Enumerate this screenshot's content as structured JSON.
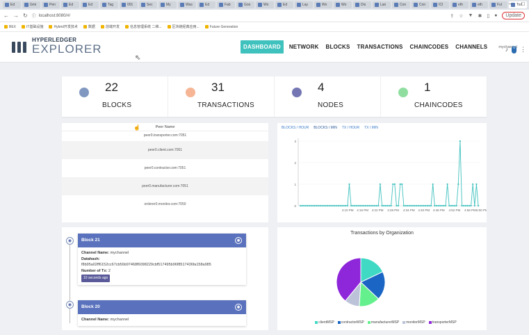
{
  "browser": {
    "tabs": [
      "Ed",
      "Gmi",
      "Pen",
      "Ed",
      "Ed",
      "Tag",
      "001",
      "Sec",
      "My",
      "Was",
      "Ed",
      "Fab",
      "Goo",
      "Wo",
      "Ed",
      "Lay",
      "Wo",
      "Wo",
      "Dis",
      "Lan",
      "Con",
      "Con",
      "ICI",
      "eth",
      "eth",
      "Ful",
      "Tod"
    ],
    "new_tab": "+",
    "url": "localhost:8080/#/",
    "profile_label": "Update",
    "bookmarks": [
      "BEX",
      "IT基础设施",
      "Hybrid开发技术",
      "数据",
      "前端开发",
      "信息管理系统 二维...",
      "区块链经典应用...",
      "Future Generation"
    ]
  },
  "app": {
    "logo_top": "HYPERLEDGER",
    "logo_bottom": "EXPLORER",
    "nav": [
      {
        "label": "DASHBOARD",
        "active": true
      },
      {
        "label": "NETWORK",
        "active": false
      },
      {
        "label": "BLOCKS",
        "active": false
      },
      {
        "label": "TRANSACTIONS",
        "active": false
      },
      {
        "label": "CHAINCODES",
        "active": false
      },
      {
        "label": "CHANNELS",
        "active": false
      }
    ],
    "channel": "mychannel",
    "notification_count": "0"
  },
  "stats": [
    {
      "value": "22",
      "label": "BLOCKS",
      "icon": "blocks-icon",
      "color": "#6a86b5"
    },
    {
      "value": "31",
      "label": "TRANSACTIONS",
      "icon": "transactions-icon",
      "color": "#f4a882"
    },
    {
      "value": "4",
      "label": "NODES",
      "icon": "nodes-icon",
      "color": "#5b5ea6"
    },
    {
      "value": "1",
      "label": "CHAINCODES",
      "icon": "chaincodes-icon",
      "color": "#7bd88f"
    }
  ],
  "peers": {
    "header": "Peer Name",
    "rows": [
      "peer0.transporter.com:7051",
      "peer0.client.com:7051",
      "peer0.contractor.com:7051",
      "peer0.manufacturer.com:7051",
      "orderer0.monitor.com:7050"
    ]
  },
  "line_chart": {
    "tabs": [
      "BLOCKS / HOUR",
      "BLOCKS / MIN",
      "TX / HOUR",
      "TX / MIN"
    ]
  },
  "chart_data": [
    {
      "type": "line",
      "x": [
        "4:10 PM",
        "4:16 PM",
        "4:22 PM",
        "4:28 PM",
        "4:34 PM",
        "4:40 PM",
        "4:46 PM",
        "4:52 PM",
        "4:58 PM",
        "5:00 PM"
      ],
      "series": [
        {
          "values": [
            0,
            0,
            0,
            0,
            0,
            0,
            0,
            0,
            0,
            0,
            0,
            0,
            0,
            0,
            0,
            0,
            0,
            0,
            0,
            0,
            0,
            0,
            0,
            0,
            0,
            0,
            0,
            1,
            0,
            0,
            0,
            0,
            0,
            0,
            0,
            0,
            0,
            0,
            0,
            0,
            0,
            0,
            0,
            0,
            1,
            0,
            0,
            0,
            0,
            0,
            0,
            1,
            1,
            0,
            0,
            1,
            1,
            0,
            0,
            0,
            0,
            0,
            0,
            0,
            0,
            0,
            0,
            0,
            0,
            0,
            0,
            0,
            0,
            1,
            0,
            0,
            0,
            0,
            0,
            0,
            0,
            1,
            0,
            0,
            0,
            0,
            0,
            1,
            3,
            0,
            0,
            0,
            0,
            0,
            0,
            1,
            0,
            1,
            0
          ]
        }
      ],
      "ylim": [
        0,
        3
      ],
      "yticks": [
        "0",
        "1",
        "2",
        "3"
      ],
      "color": "#3fc1bd"
    },
    {
      "type": "pie",
      "title": "Transactions by Organization",
      "categories": [
        "clientMSP",
        "contractorMSP",
        "manufacturerMSP",
        "monitorMSP",
        "transporterMSP"
      ],
      "values": [
        18,
        19,
        14,
        10,
        39
      ],
      "colors": [
        "#3fd9c4",
        "#1b66c4",
        "#65f08e",
        "#bcc3d9",
        "#8e26d9"
      ]
    }
  ],
  "blocks_list": [
    {
      "title": "Block 21",
      "channel_label": "Channel Name:",
      "channel": "mychannel",
      "datahash_label": "Datahash:",
      "datahash": "f8b95a02ff6152cc67cb56b97468f6098229cbf517495b96f8517436fa158a985",
      "tx_label": "Number of Tx:",
      "tx": "2",
      "time": "10 seconds ago"
    },
    {
      "title": "Block 20",
      "channel_label": "Channel Name:",
      "channel": "mychannel"
    }
  ]
}
